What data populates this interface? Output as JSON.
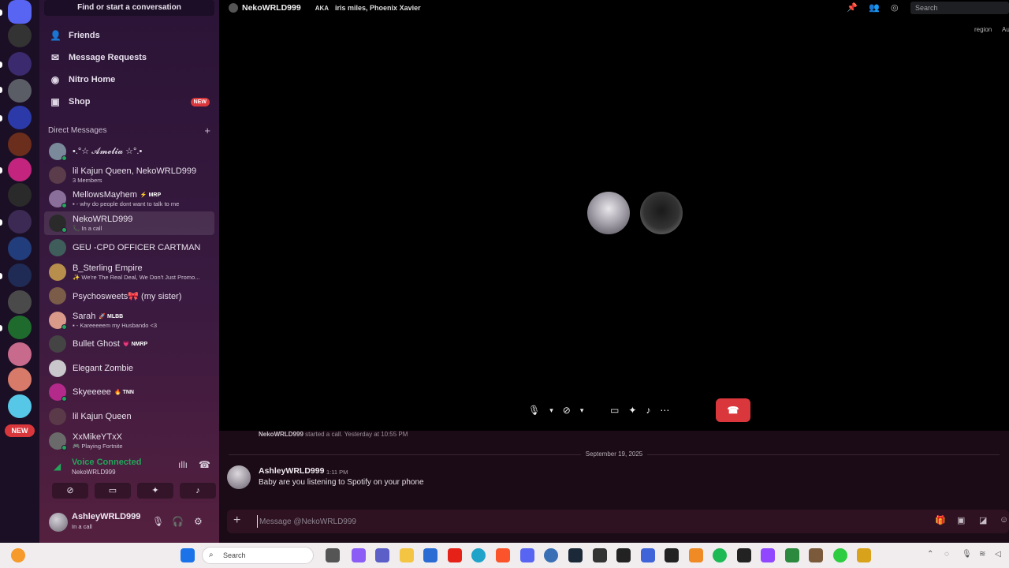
{
  "sidebar": {
    "find_label": "Find or start a conversation",
    "nav": [
      {
        "label": "Friends",
        "icon": "friends-icon"
      },
      {
        "label": "Message Requests",
        "icon": "mail-icon"
      },
      {
        "label": "Nitro Home",
        "icon": "nitro-icon"
      },
      {
        "label": "Shop",
        "icon": "shop-icon",
        "badge": "NEW"
      }
    ],
    "dm_header": "Direct Messages",
    "dms": [
      {
        "name": "•.°☆ 𝓐𝓶𝓮𝓵𝓲𝓪 ☆°.•",
        "sub": ""
      },
      {
        "name": "lil Kajun Queen, NekoWRLD999",
        "sub": "3 Members"
      },
      {
        "name": "MellowsMayhem",
        "tag": "⚡ MRP",
        "sub": "▪ - why do people dont want to talk to me"
      },
      {
        "name": "NekoWRLD999",
        "sub": "📞 In a call"
      },
      {
        "name": "GEU -CPD OFFICER CARTMAN",
        "sub": ""
      },
      {
        "name": "B_Sterling Empire",
        "sub": "✨ We're The Real Deal, We Don't Just Promo..."
      },
      {
        "name": "Psychosweets🎀 (my sister)",
        "sub": ""
      },
      {
        "name": "Sarah",
        "tag": "🚀 MLBB",
        "sub": "▪ - Kareeeeem my Husbando <3"
      },
      {
        "name": "Bullet Ghost",
        "tag": "💗 NMRP",
        "sub": ""
      },
      {
        "name": "Elegant Zombie",
        "sub": ""
      },
      {
        "name": "Skyeeeee",
        "tag": "🔥 TNN",
        "sub": ""
      },
      {
        "name": "lil Kajun Queen",
        "sub": ""
      },
      {
        "name": "XxMikeYTxX",
        "sub": "🎮 Playing Fortnite"
      }
    ],
    "voice": {
      "status": "Voice Connected",
      "channel": "NekoWRLD999"
    },
    "user": {
      "name": "AshleyWRLD999",
      "status": "In a call"
    }
  },
  "rail": {
    "new_badge": "NEW"
  },
  "header": {
    "title": "NekoWRLD999",
    "aka_label": "AKA",
    "aka_value": "iris miles, Phoenix Xavier",
    "search_placeholder": "Search",
    "region_label": "region",
    "region_value": "Au"
  },
  "chat": {
    "system_user": "NekoWRLD999",
    "system_text": " started a call. Yesterday at 10:55 PM",
    "date": "September 19, 2025",
    "message": {
      "author": "AshleyWRLD999",
      "time": "1:11 PM",
      "text": "Baby are you listening to Spotify on your phone"
    },
    "composer_placeholder": "Message @NekoWRLD999"
  },
  "taskbar": {
    "search_placeholder": "Search"
  },
  "colors": {
    "accent_red": "#da373c",
    "online_green": "#23a55a",
    "sidebar_top": "#2a1436",
    "sidebar_bottom": "#55203f"
  }
}
